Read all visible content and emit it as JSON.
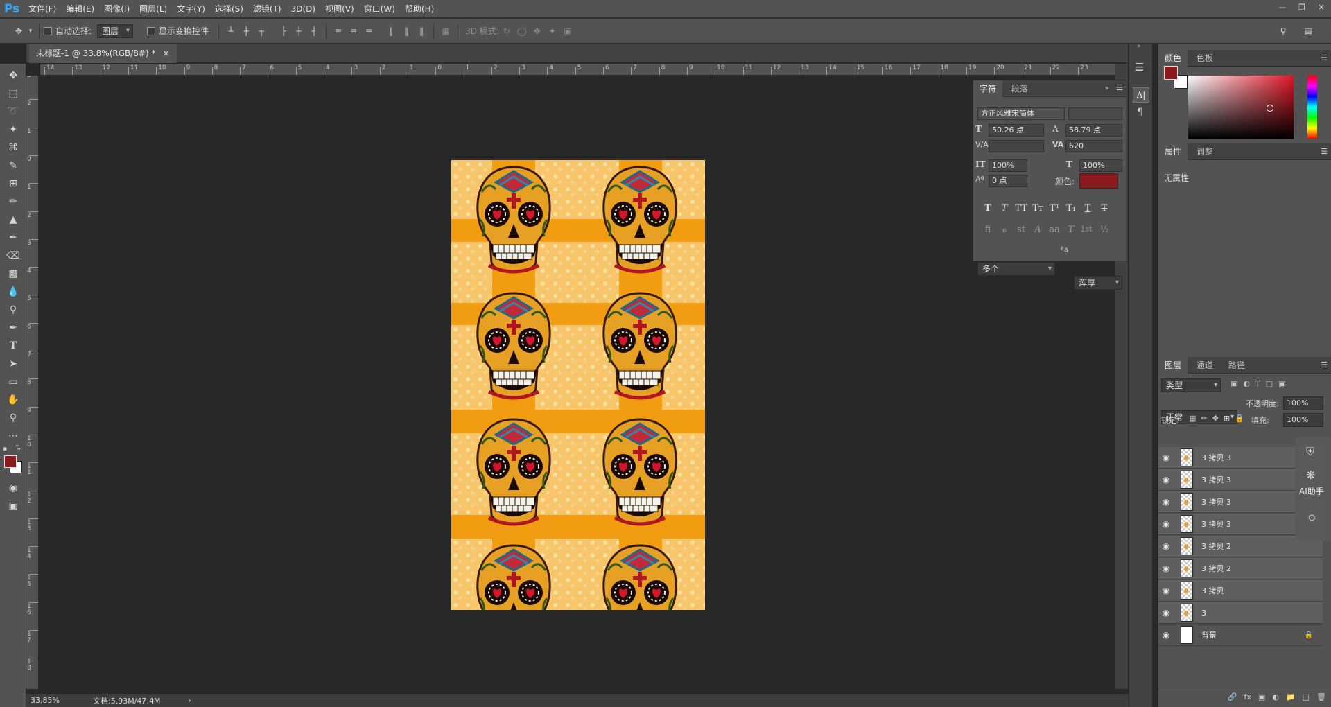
{
  "app": {
    "logo": "Ps"
  },
  "menu": [
    "文件(F)",
    "编辑(E)",
    "图像(I)",
    "图层(L)",
    "文字(Y)",
    "选择(S)",
    "滤镜(T)",
    "3D(D)",
    "视图(V)",
    "窗口(W)",
    "帮助(H)"
  ],
  "options": {
    "auto_select_label": "自动选择:",
    "auto_select_target": "图层",
    "show_transform_label": "显示变换控件",
    "mode_3d_label": "3D 模式:"
  },
  "document": {
    "tab_title": "未标题-1 @ 33.8%(RGB/8#) *",
    "close_glyph": "×",
    "zoom": "33.85%",
    "doc_info": "文档:5.93M/47.4M",
    "hruler_labels": [
      "14",
      "13",
      "12",
      "11",
      "10",
      "9",
      "8",
      "7",
      "6",
      "5",
      "4",
      "3",
      "2",
      "1",
      "0",
      "1",
      "2",
      "3",
      "4",
      "5",
      "6",
      "7",
      "8",
      "9",
      "10",
      "11",
      "12",
      "13",
      "14",
      "15",
      "16",
      "17",
      "18",
      "19",
      "20",
      "21",
      "22",
      "23"
    ],
    "vruler_labels": [
      "3",
      "2",
      "1",
      "0",
      "1",
      "2",
      "3",
      "4",
      "5",
      "6",
      "7",
      "8",
      "9",
      "1\n0",
      "1\n1",
      "1\n2",
      "1\n3",
      "1\n4",
      "1\n5",
      "1\n6",
      "1\n7",
      "1\n8"
    ]
  },
  "character_panel": {
    "tabs": [
      "字符",
      "段落"
    ],
    "font_family": "方正风雅宋简体",
    "font_style": "",
    "font_size": "50.26 点",
    "leading": "58.79 点",
    "kerning": "",
    "tracking": "620",
    "vertical_scale": "100%",
    "horizontal_scale": "100%",
    "baseline_shift": "0 点",
    "color_label": "颜色:",
    "text_color": "#8b1a1f",
    "style_buttons": [
      "T",
      "T",
      "TT",
      "Tт",
      "T¹",
      "T₁",
      "T",
      "T"
    ],
    "opentype_buttons": [
      "fi",
      "ℴ",
      "st",
      "A",
      "aa",
      "T",
      "1st",
      "½"
    ],
    "language": "多个",
    "antialias_label": "ªa",
    "antialias": "浑厚"
  },
  "color_panel": {
    "tabs": [
      "颜色",
      "色板"
    ],
    "foreground": "#8b1a1f",
    "background": "#ffffff"
  },
  "properties_panel": {
    "tabs": [
      "属性",
      "调整"
    ],
    "empty_text": "无属性"
  },
  "layers_panel": {
    "tabs": [
      "图层",
      "通道",
      "路径"
    ],
    "filter_kind": "类型",
    "blend_mode": "正常",
    "opacity_label": "不透明度:",
    "opacity": "100%",
    "lock_label": "锁定:",
    "fill_label": "填充:",
    "fill": "100%",
    "layers": [
      {
        "name": "3 拷贝 3",
        "type": "layer"
      },
      {
        "name": "3 拷贝 3",
        "type": "layer"
      },
      {
        "name": "3 拷贝 3",
        "type": "layer"
      },
      {
        "name": "3 拷贝 3",
        "type": "layer"
      },
      {
        "name": "3 拷贝 2",
        "type": "layer"
      },
      {
        "name": "3 拷贝 2",
        "type": "layer"
      },
      {
        "name": "3 拷贝",
        "type": "layer"
      },
      {
        "name": "3",
        "type": "layer"
      },
      {
        "name": "背景",
        "type": "background"
      }
    ]
  },
  "ai_helper": {
    "label": "AI助手"
  },
  "icons": [
    "move-icon",
    "marquee-icon",
    "lasso-icon",
    "magic-wand-icon",
    "crop-icon",
    "eyedropper-icon",
    "frame-icon",
    "brush-icon",
    "stamp-icon",
    "history-brush-icon",
    "eraser-icon",
    "gradient-icon",
    "blur-icon",
    "dodge-icon",
    "pen-icon",
    "type-icon",
    "path-select-icon",
    "rectangle-icon",
    "hand-icon",
    "zoom-icon",
    "more-icon",
    "eye-icon",
    "lock-icon",
    "search-icon",
    "workspace-icon"
  ]
}
